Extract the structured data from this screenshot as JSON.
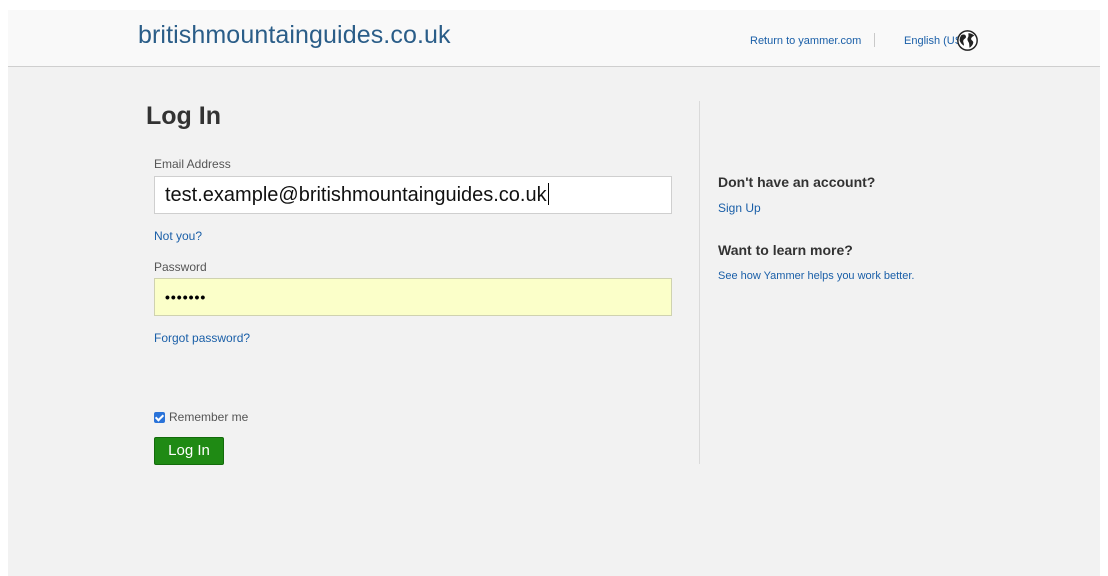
{
  "header": {
    "brand": "britishmountainguides.co.uk",
    "return_link": "Return to yammer.com",
    "language": "English (US)",
    "globe_icon": "globe-icon"
  },
  "form": {
    "title": "Log In",
    "email_label": "Email Address",
    "email_value": "test.example@britishmountainguides.co.uk",
    "not_you": "Not you?",
    "password_label": "Password",
    "password_value": "•••••••",
    "forgot_password": "Forgot password?",
    "remember_label": "Remember me",
    "remember_checked": true,
    "login_button": "Log In"
  },
  "sidebar": {
    "no_account_heading": "Don't have an account?",
    "signup_link": "Sign Up",
    "learn_heading": "Want to learn more?",
    "learn_link": "See how Yammer helps you work better."
  },
  "colors": {
    "brand_text": "#2a5d88",
    "link": "#1a5fa8",
    "button": "#1f8a14",
    "autofill": "#fbffc9"
  }
}
